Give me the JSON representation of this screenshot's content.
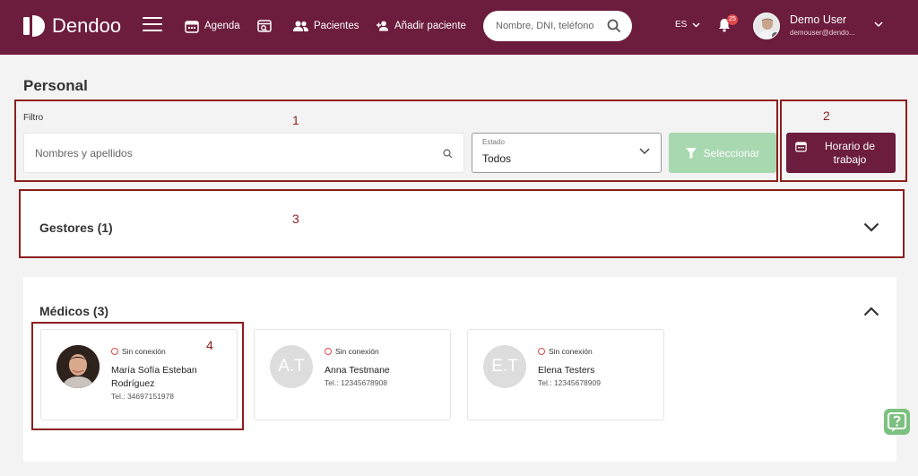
{
  "brand": {
    "name": "Dendoo"
  },
  "nav": {
    "agenda": "Agenda",
    "pacientes": "Pacientes",
    "anadir": "Añadir paciente"
  },
  "search": {
    "placeholder": "Nombre, DNI, teléfono"
  },
  "lang": "ES",
  "notifications": {
    "count": "25"
  },
  "user": {
    "name": "Demo User",
    "email": "demouser@dendo..."
  },
  "page": {
    "title": "Personal"
  },
  "filter": {
    "label": "Filtro",
    "name_placeholder": "Nombres y apellidos",
    "estado_label": "Estado",
    "estado_value": "Todos",
    "select_button": "Seleccionar",
    "schedule_button": "Horario de trabajo"
  },
  "annotations": [
    "1",
    "2",
    "3",
    "4"
  ],
  "gestores": {
    "title": "Gestores (1)"
  },
  "medicos": {
    "title": "Médicos (3)",
    "cards": [
      {
        "status": "Sin conexión",
        "name": "María Sofía Esteban Rodríguez",
        "tel": "Tel.: 34697151978",
        "initials": ""
      },
      {
        "status": "Sin conexión",
        "name": "Anna Testmane",
        "tel": "Tel.: 12345678908",
        "initials": "A.T"
      },
      {
        "status": "Sin conexión",
        "name": "Elena Testers",
        "tel": "Tel.: 12345678909",
        "initials": "E.T"
      }
    ]
  },
  "colors": {
    "brand": "#6c1c3c",
    "select_button": "#a8d8b0",
    "annotation": "#8b1f1f",
    "offline": "#e0484a",
    "help": "#7cc17f"
  }
}
